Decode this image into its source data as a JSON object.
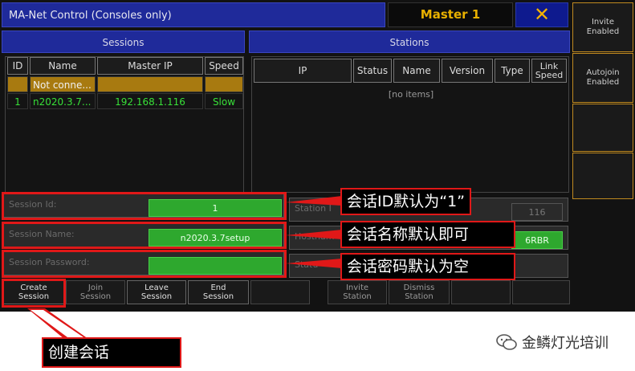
{
  "window": {
    "title": "MA-Net Control (Consoles only)",
    "master_label": "Master 1",
    "close_glyph": "✕"
  },
  "side_buttons": {
    "invite_enabled": "Invite\nEnabled",
    "autojoin_enabled": "Autojoin\nEnabled"
  },
  "sessions": {
    "header": "Sessions",
    "columns": [
      "ID",
      "Name",
      "Master IP",
      "Speed"
    ],
    "rows": [
      {
        "id": "",
        "name": "Not conne...",
        "master_ip": "",
        "speed": ""
      },
      {
        "id": "1",
        "name": "n2020.3.7...",
        "master_ip": "192.168.1.116",
        "speed": "Slow"
      }
    ]
  },
  "stations": {
    "header": "Stations",
    "columns": [
      "IP",
      "Status",
      "Name",
      "Version",
      "Type",
      "Link\nSpeed"
    ],
    "empty_text": "[no items]"
  },
  "fields": {
    "session_id_label": "Session Id:",
    "session_id_value": "1",
    "session_name_label": "Session Name:",
    "session_name_value": "n2020.3.7setup",
    "session_password_label": "Session Password:",
    "session_password_value": "",
    "station_ip_label": "Station I",
    "station_ip_value": "116",
    "hostname_label": "Hostnam",
    "hostname_value": "6RBR",
    "status_label": "Statu"
  },
  "bottom_buttons": {
    "create": "Create\nSession",
    "join": "Join\nSession",
    "leave": "Leave\nSession",
    "end": "End\nSession",
    "invite": "Invite\nStation",
    "dismiss": "Dismiss\nStation"
  },
  "annotations": {
    "session_id_note": "会话ID默认为“1”",
    "session_name_note": "会话名称默认即可",
    "session_password_note": "会话密码默认为空",
    "create_note": "创建会话"
  },
  "watermark": {
    "text": "金鳞灯光培训"
  },
  "colors": {
    "title_blue": "#1f2a9a",
    "master_amber": "#e8b000",
    "field_green": "#2ea82e",
    "annotation_red": "#e01818",
    "side_border": "#c08a20"
  }
}
